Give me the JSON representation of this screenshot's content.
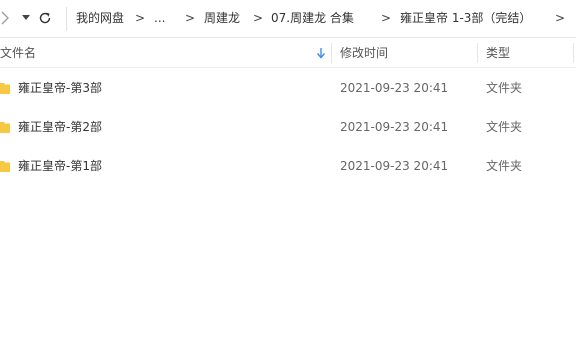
{
  "toolbar": {
    "icons": [
      "chevron-right-icon",
      "chevron-down-icon",
      "refresh-icon"
    ],
    "breadcrumbs": [
      "我的网盘",
      "...",
      "周建龙",
      "07.周建龙 合集",
      "雍正皇帝 1-3部（完结）"
    ],
    "separator": ">"
  },
  "columns": {
    "name": "文件名",
    "modified": "修改时间",
    "type": "类型",
    "sort_icon": "sort-down-arrow-icon"
  },
  "rows": [
    {
      "icon": "folder-icon",
      "name": "雍正皇帝-第3部",
      "modified": "2021-09-23 20:41",
      "type": "文件夹"
    },
    {
      "icon": "folder-icon",
      "name": "雍正皇帝-第2部",
      "modified": "2021-09-23 20:41",
      "type": "文件夹"
    },
    {
      "icon": "folder-icon",
      "name": "雍正皇帝-第1部",
      "modified": "2021-09-23 20:41",
      "type": "文件夹"
    }
  ],
  "colors": {
    "folder": "#f7c844",
    "sort_arrow": "#3a8ee6",
    "divider": "#e6e6e6"
  }
}
